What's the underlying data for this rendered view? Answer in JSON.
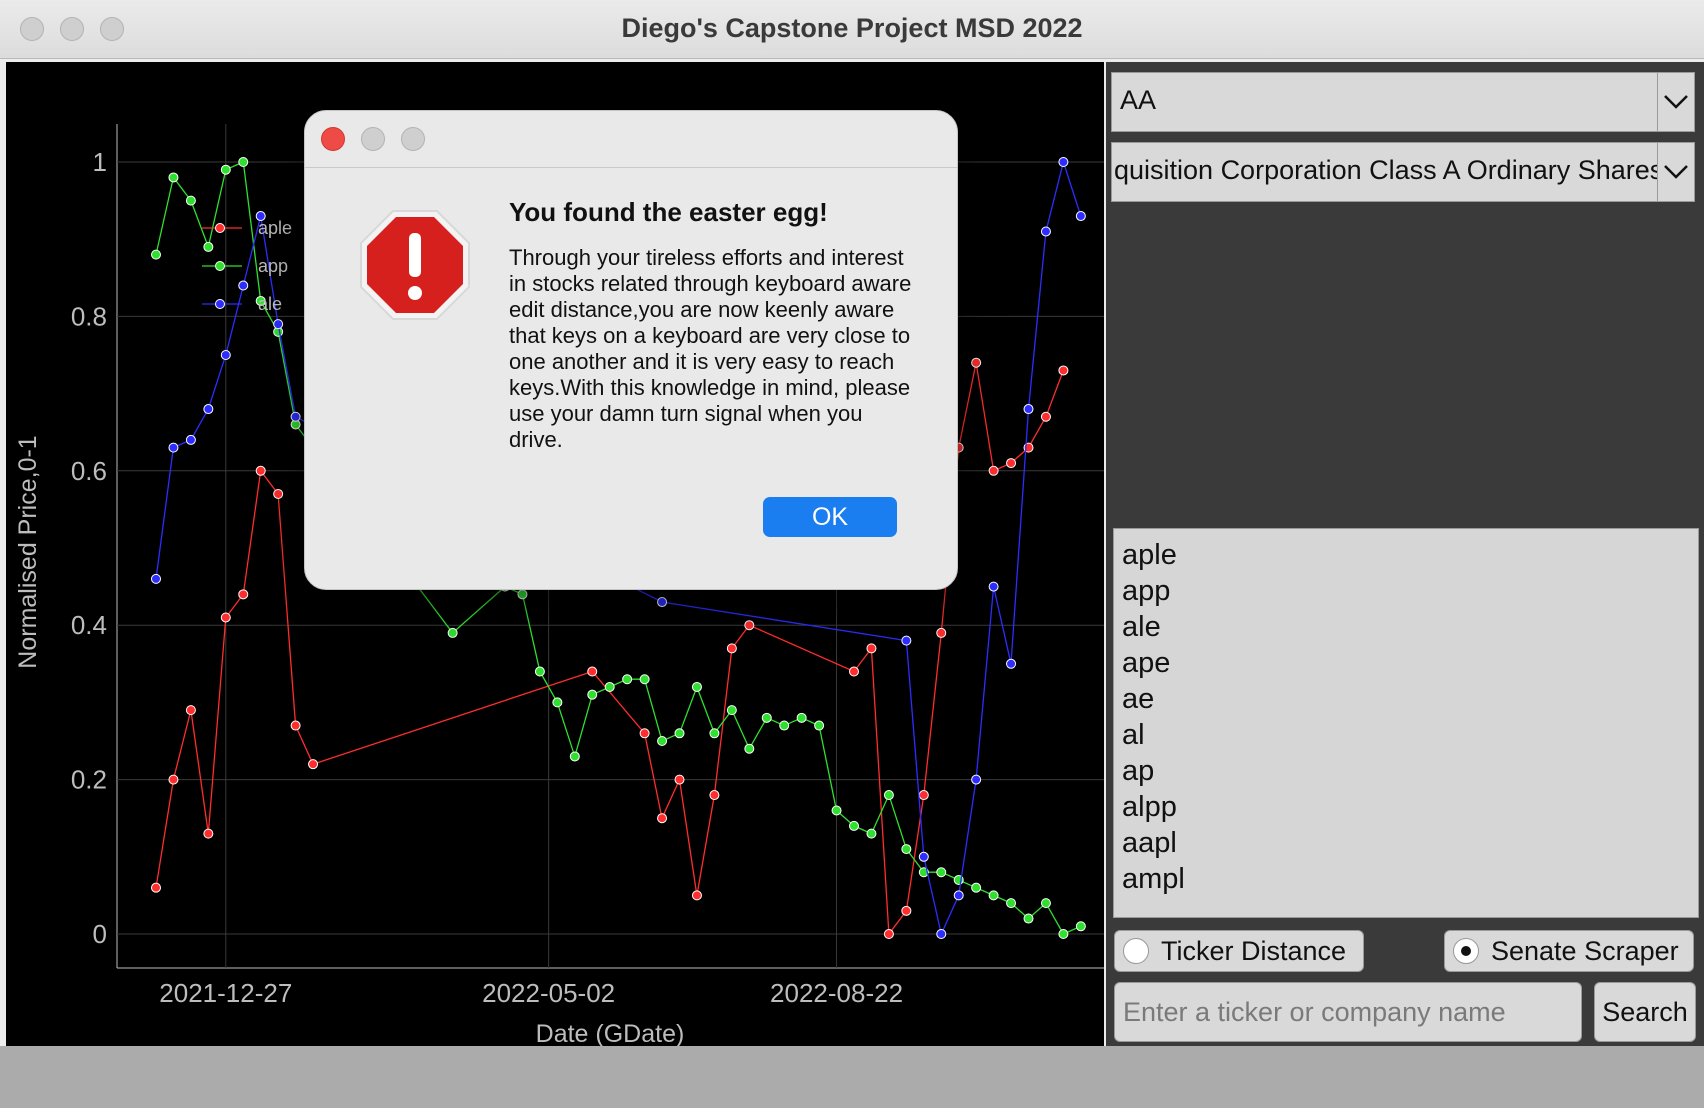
{
  "window": {
    "title": "Diego's Capstone Project MSD 2022"
  },
  "right_panel": {
    "combo1": {
      "value": "AA"
    },
    "combo2": {
      "value": "quisition Corporation Class A Ordinary Shares"
    },
    "suggestions": [
      "aple",
      "app",
      "ale",
      "ape",
      "ae",
      "al",
      "ap",
      "alpp",
      "aapl",
      "ampl"
    ],
    "radio_ticker": {
      "label": "Ticker Distance",
      "selected": false
    },
    "radio_senate": {
      "label": "Senate Scraper",
      "selected": true
    },
    "search_input": {
      "value": "",
      "placeholder": "Enter a ticker or company name"
    },
    "search_button": {
      "label": "Search"
    }
  },
  "dialog": {
    "heading": "You found the easter egg!",
    "body": "Through your tireless efforts and interest in stocks related through keyboard aware edit distance,you are now keenly aware that keys on a keyboard are very close to one another and it is very easy to reach keys.With this knowledge in mind, please use your damn turn signal when you drive.",
    "ok_label": "OK",
    "icon": "alert-stop-icon"
  },
  "colors": {
    "aple": "#ff2d2d",
    "app": "#2fe02f",
    "ale": "#2d2dff",
    "ok_button": "#1a7df0"
  },
  "chart_data": {
    "type": "line",
    "xlabel": "Date (GDate)",
    "ylabel": "Normalised Price,0-1",
    "ylim": [
      0,
      1.05
    ],
    "yticks": [
      "0",
      "0.2",
      "0.4",
      "0.6",
      "0.8",
      "1"
    ],
    "xticks": [
      "2021-12-27",
      "2022-05-02",
      "2022-08-22"
    ],
    "grid": true,
    "legend_position": "top-left",
    "series": [
      {
        "name": "aple",
        "points": [
          [
            0,
            0.06
          ],
          [
            1,
            0.2
          ],
          [
            2,
            0.29
          ],
          [
            3,
            0.13
          ],
          [
            4,
            0.41
          ],
          [
            5,
            0.44
          ],
          [
            6,
            0.6
          ],
          [
            7,
            0.57
          ],
          [
            8,
            0.27
          ],
          [
            9,
            0.22
          ],
          [
            25,
            0.34
          ],
          [
            28,
            0.26
          ],
          [
            29,
            0.15
          ],
          [
            30,
            0.2
          ],
          [
            31,
            0.05
          ],
          [
            32,
            0.18
          ],
          [
            33,
            0.37
          ],
          [
            34,
            0.4
          ],
          [
            40,
            0.34
          ],
          [
            41,
            0.37
          ],
          [
            42,
            0.0
          ],
          [
            43,
            0.03
          ],
          [
            44,
            0.18
          ],
          [
            45,
            0.39
          ],
          [
            46,
            0.63
          ],
          [
            47,
            0.74
          ],
          [
            48,
            0.6
          ],
          [
            49,
            0.61
          ],
          [
            50,
            0.63
          ],
          [
            51,
            0.67
          ],
          [
            52,
            0.73
          ]
        ]
      },
      {
        "name": "app",
        "points": [
          [
            0,
            0.88
          ],
          [
            1,
            0.98
          ],
          [
            2,
            0.95
          ],
          [
            3,
            0.89
          ],
          [
            4,
            0.99
          ],
          [
            5,
            1.0
          ],
          [
            6,
            0.82
          ],
          [
            7,
            0.78
          ],
          [
            8,
            0.66
          ],
          [
            17,
            0.39
          ],
          [
            20,
            0.45
          ],
          [
            21,
            0.44
          ],
          [
            22,
            0.34
          ],
          [
            23,
            0.3
          ],
          [
            24,
            0.23
          ],
          [
            25,
            0.31
          ],
          [
            26,
            0.32
          ],
          [
            27,
            0.33
          ],
          [
            28,
            0.33
          ],
          [
            29,
            0.25
          ],
          [
            30,
            0.26
          ],
          [
            31,
            0.32
          ],
          [
            32,
            0.26
          ],
          [
            33,
            0.29
          ],
          [
            34,
            0.24
          ],
          [
            35,
            0.28
          ],
          [
            36,
            0.27
          ],
          [
            37,
            0.28
          ],
          [
            38,
            0.27
          ],
          [
            39,
            0.16
          ],
          [
            40,
            0.14
          ],
          [
            41,
            0.13
          ],
          [
            42,
            0.18
          ],
          [
            43,
            0.11
          ],
          [
            44,
            0.08
          ],
          [
            45,
            0.08
          ],
          [
            46,
            0.07
          ],
          [
            47,
            0.06
          ],
          [
            48,
            0.05
          ],
          [
            49,
            0.04
          ],
          [
            50,
            0.02
          ],
          [
            51,
            0.04
          ],
          [
            52,
            0.0
          ],
          [
            53,
            0.01
          ]
        ]
      },
      {
        "name": "ale",
        "points": [
          [
            0,
            0.46
          ],
          [
            1,
            0.63
          ],
          [
            2,
            0.64
          ],
          [
            3,
            0.68
          ],
          [
            4,
            0.75
          ],
          [
            5,
            0.84
          ],
          [
            6,
            0.93
          ],
          [
            7,
            0.79
          ],
          [
            8,
            0.67
          ],
          [
            29,
            0.43
          ],
          [
            43,
            0.38
          ],
          [
            44,
            0.1
          ],
          [
            45,
            0.0
          ],
          [
            46,
            0.05
          ],
          [
            47,
            0.2
          ],
          [
            48,
            0.45
          ],
          [
            49,
            0.35
          ],
          [
            50,
            0.68
          ],
          [
            51,
            0.91
          ],
          [
            52,
            1.0
          ],
          [
            53,
            0.93
          ]
        ]
      }
    ]
  }
}
